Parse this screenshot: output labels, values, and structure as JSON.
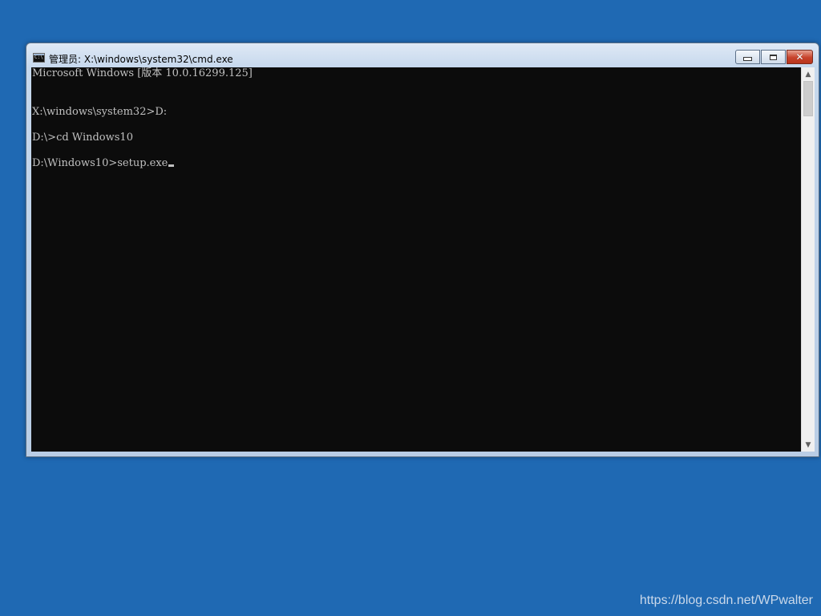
{
  "window": {
    "title": "管理员: X:\\windows\\system32\\cmd.exe",
    "icon": "cmd-icon",
    "icon_text": "C:\\"
  },
  "caption_buttons": {
    "minimize": "minimize-icon",
    "maximize": "maximize-icon",
    "close": "close-icon",
    "close_glyph": "✕"
  },
  "console": {
    "lines": [
      "Microsoft Windows [版本 10.0.16299.125]",
      "",
      "X:\\windows\\system32>D:",
      "",
      "D:\\>cd Windows10",
      "",
      "D:\\Windows10>setup.exe"
    ],
    "text_color": "#c0c0c0",
    "background": "#0c0c0c"
  },
  "scrollbar": {
    "up_glyph": "▲",
    "down_glyph": "▼"
  },
  "desktop": {
    "background": "#1f69b3",
    "watermark": "https://blog.csdn.net/WPwalter"
  }
}
